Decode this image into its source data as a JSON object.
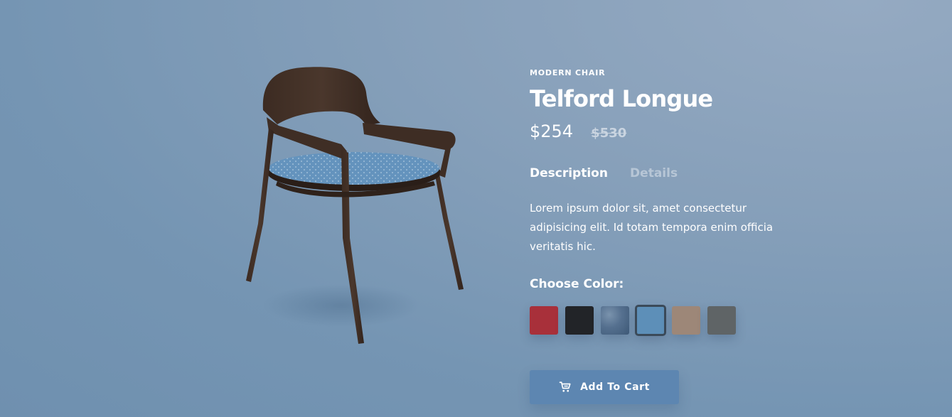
{
  "product": {
    "category": "MODERN CHAIR",
    "name": "Telford Longue",
    "price": "$254",
    "old_price": "$530"
  },
  "tabs": [
    {
      "label": "Description",
      "active": true
    },
    {
      "label": "Details",
      "active": false
    }
  ],
  "description": "Lorem ipsum dolor sit, amet consectetur adipisicing elit. Id totam tempora enim officia veritatis hic.",
  "color_picker": {
    "label": "Choose Color:",
    "selected_index": 3,
    "swatches": [
      {
        "name": "red-fabric",
        "color": "#a8303a"
      },
      {
        "name": "black-fabric",
        "color": "#222428"
      },
      {
        "name": "denim-fabric",
        "color": "#55708f"
      },
      {
        "name": "blue-fabric",
        "color": "#5d8fb8"
      },
      {
        "name": "beige-fabric",
        "color": "#9d8778"
      },
      {
        "name": "grey-fabric",
        "color": "#5f6466"
      }
    ]
  },
  "cart_button": {
    "label": "Add To Cart",
    "icon": "cart-icon"
  },
  "colors": {
    "accent": "#5d86b1",
    "background": "#7f9bb8",
    "inactive_tab": "#b7c6d6",
    "old_price": "#c9d4e0"
  }
}
